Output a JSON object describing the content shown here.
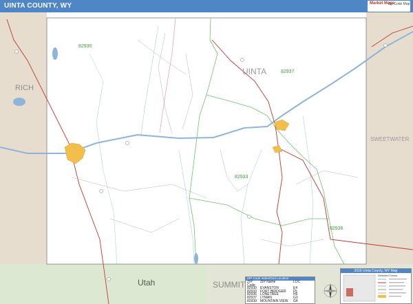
{
  "title": "UINTA COUNTY, WY",
  "logo": {
    "text": "Market Maps",
    "sub": "Zip Code Map"
  },
  "map_labels": {
    "neighbor_rich": "RICH",
    "county_name": "UINTA",
    "neighbor_sweetwater": "SWEETWATER",
    "state_utah": "Utah",
    "neighbor_summit": "SUMMIT"
  },
  "zip_labels": [
    "82930",
    "82937",
    "82933",
    "82936"
  ],
  "zip_index": {
    "title": "ZIP Code Index/Grid Location",
    "headers": [
      "ZIP Code",
      "ZIP Name",
      "LOC"
    ],
    "rows": [
      [
        "82930",
        "EVANSTON",
        "E4"
      ],
      [
        "82933",
        "FORT BRIDGER",
        "F5"
      ],
      [
        "82936",
        "LONETREE",
        "H6"
      ],
      [
        "82937",
        "LYMAN",
        "G3"
      ],
      [
        "82939",
        "MOUNTAIN VIEW",
        "G4"
      ]
    ]
  },
  "inset": {
    "title": "2016 Uinta County, WY Map",
    "legend_title": "Selected Towns"
  },
  "colors": {
    "title_bar": "#4f86c6",
    "neighbor_fill": "#e6ddcf",
    "utah_fill": "#dde8d2",
    "water": "#8fb4d9",
    "zip_boundary": "#6cc36c",
    "interstate": "#8fb4d9",
    "highway": "#c0392b",
    "city": "#f2c04a"
  }
}
